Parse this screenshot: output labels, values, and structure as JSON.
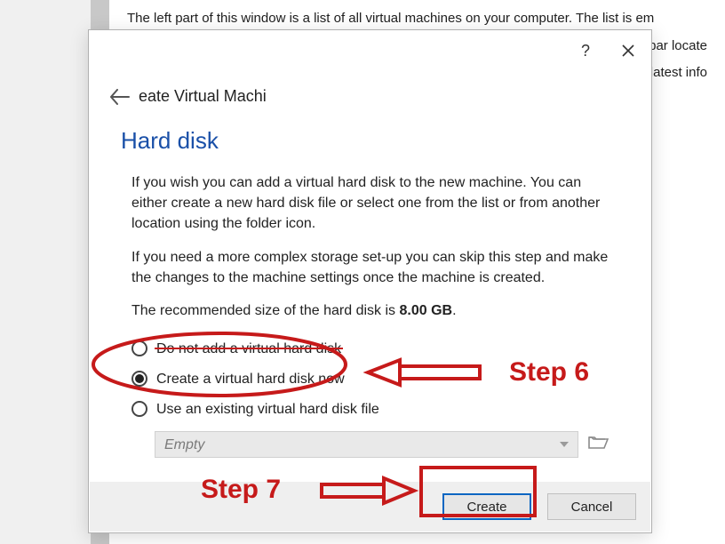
{
  "background": {
    "line1": "The left part of this window is a list of all virtual machines on your computer. The list is em",
    "line2": "ol bar locate",
    "line3": "e latest info"
  },
  "titlebar": {
    "help_tooltip": "?",
    "close_tooltip": "✕"
  },
  "breadcrumb": {
    "label": "eate Virtual Machi"
  },
  "heading": "Hard disk",
  "paragraphs": {
    "p1": "If you wish you can add a virtual hard disk to the new machine. You can either create a new hard disk file or select one from the list or from another location using the folder icon.",
    "p2": "If you need a more complex storage set-up you can skip this step and make the changes to the machine settings once the machine is created."
  },
  "recommendation": {
    "prefix": "The recommended size of the hard disk is ",
    "size": "8.00 GB",
    "suffix": "."
  },
  "options": {
    "none": "Do not add a virtual hard disk",
    "create": "Create a virtual hard disk now",
    "existing": "Use an existing virtual hard disk file"
  },
  "dropdown": {
    "value": "Empty"
  },
  "buttons": {
    "create": "Create",
    "cancel": "Cancel"
  },
  "annotations": {
    "step6": "Step 6",
    "step7": "Step 7"
  }
}
